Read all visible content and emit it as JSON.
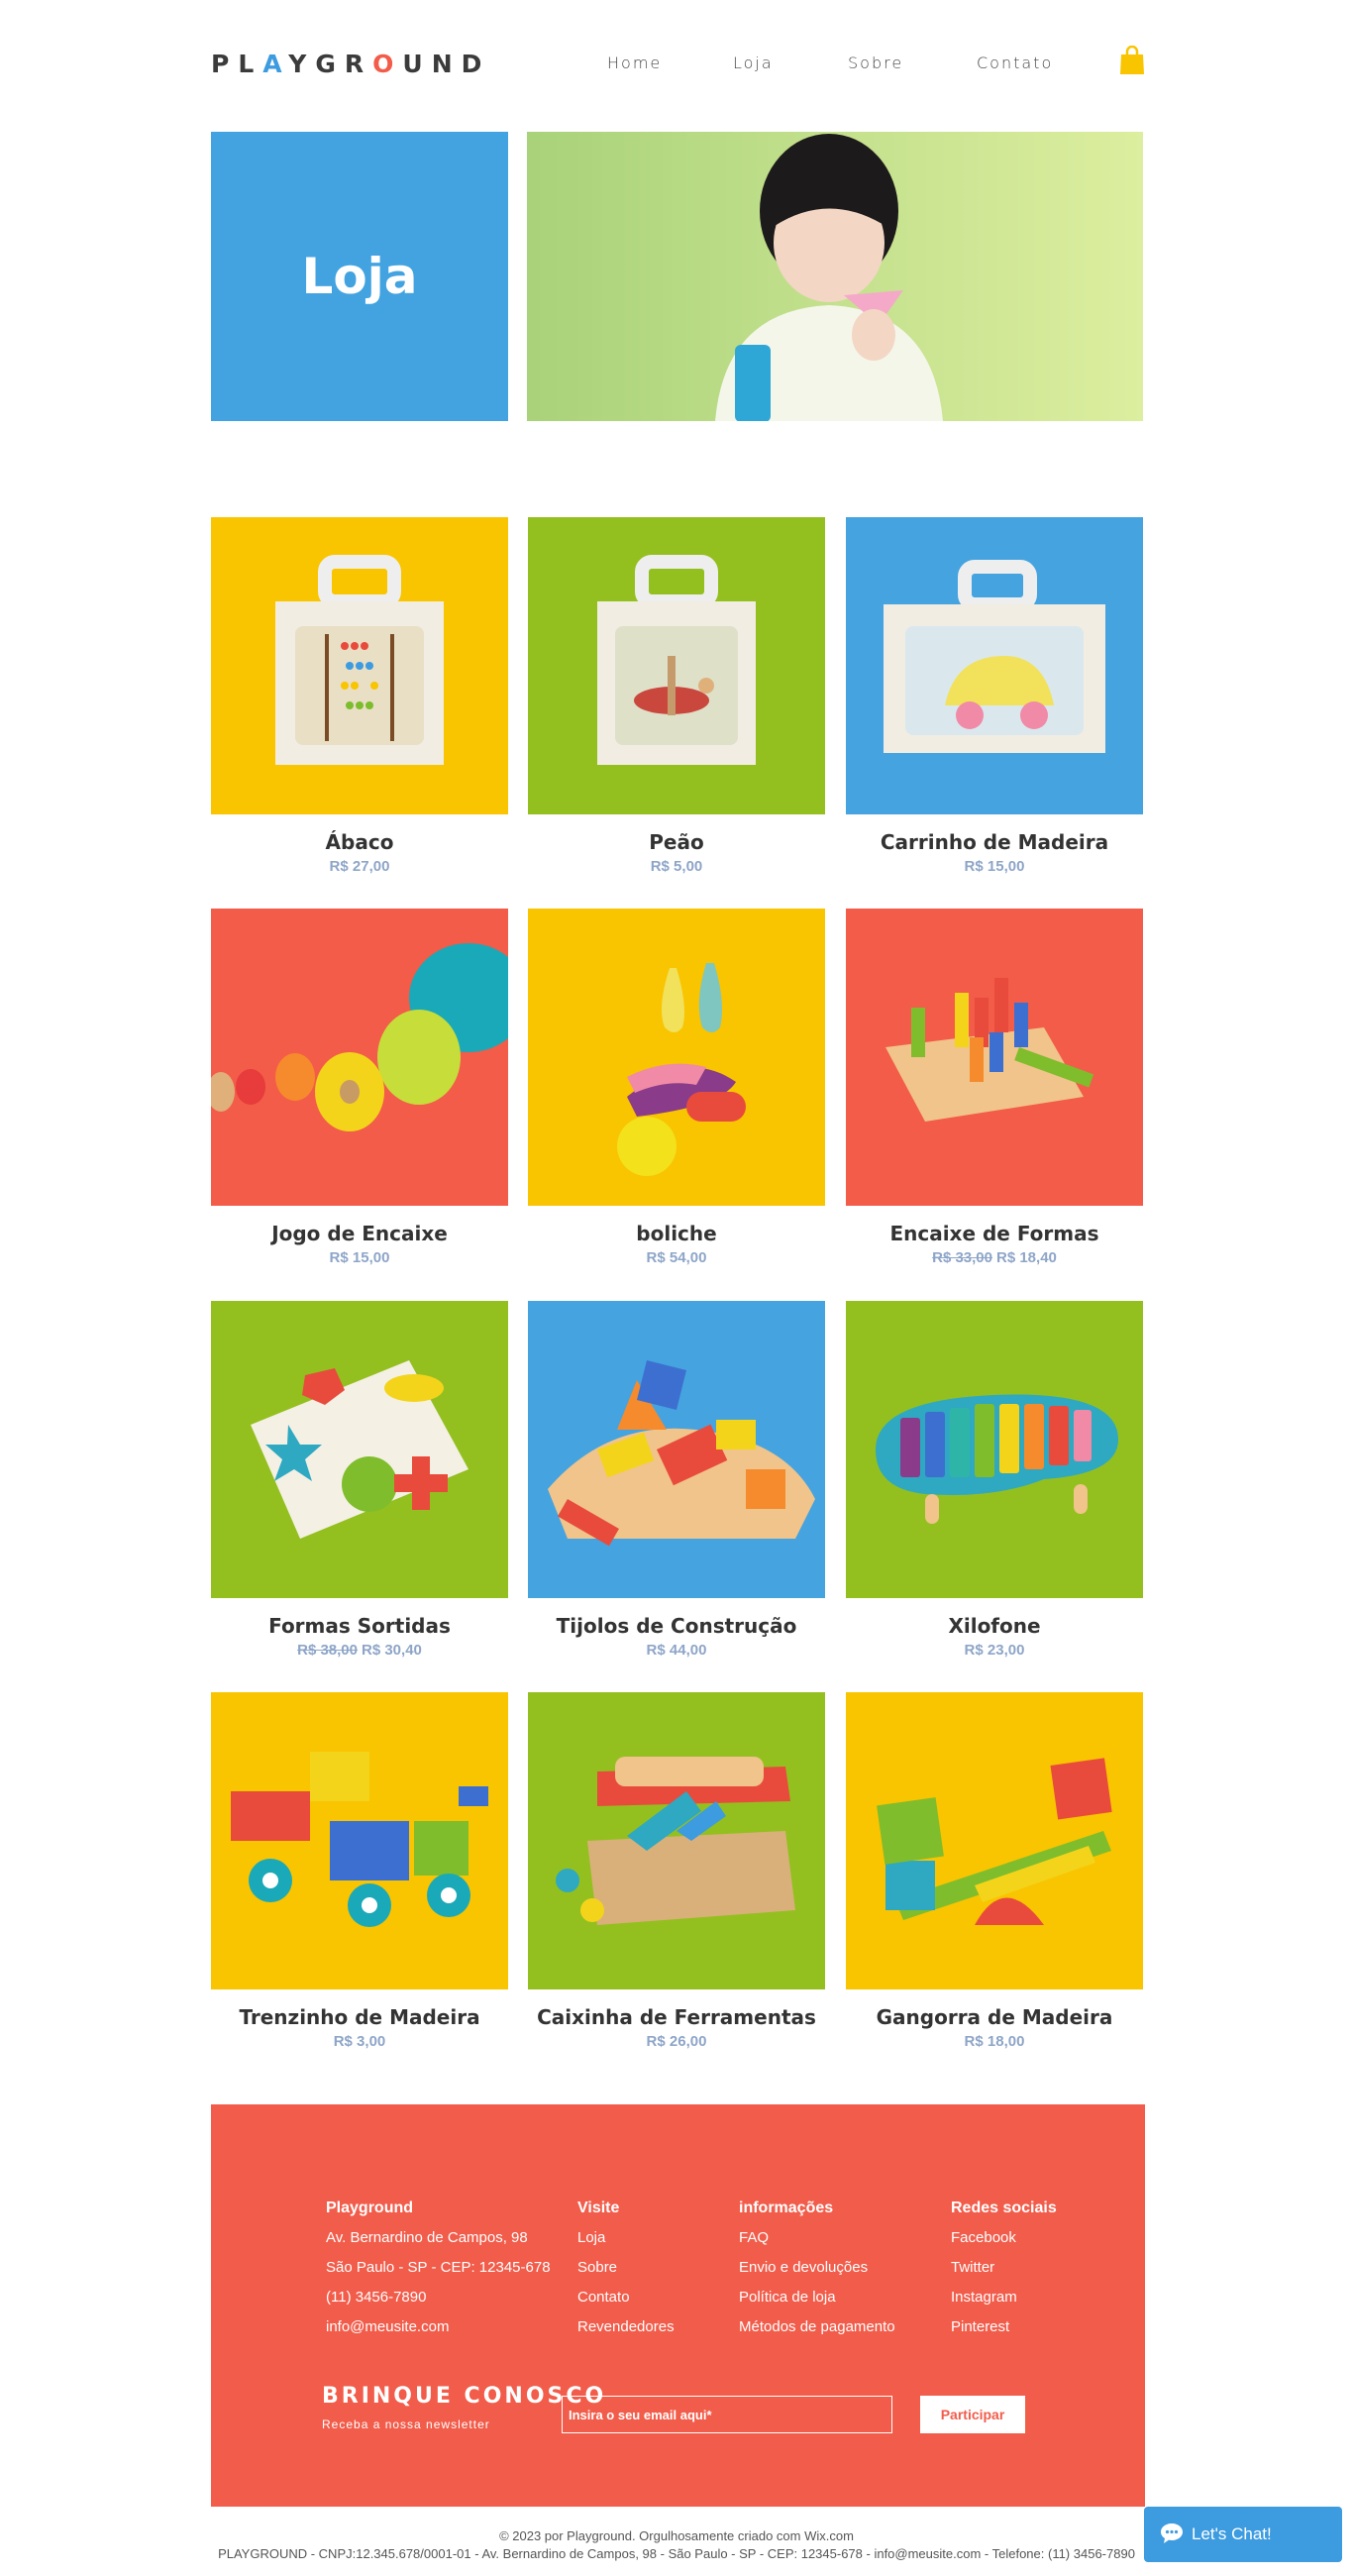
{
  "header": {
    "logo_letters": [
      "P",
      "L",
      "A",
      "Y",
      "G",
      "R",
      "O",
      "U",
      "N",
      "D"
    ],
    "nav": [
      {
        "label": "Home"
      },
      {
        "label": "Loja"
      },
      {
        "label": "Sobre"
      },
      {
        "label": "Contato"
      }
    ],
    "cart_icon": "shopping-bag-icon"
  },
  "hero": {
    "title": "Loja"
  },
  "products": [
    {
      "name": "Ábaco",
      "price": "R$ 27,00",
      "old_price": "",
      "bg": "#f9c400"
    },
    {
      "name": "Peão",
      "price": "R$ 5,00",
      "old_price": "",
      "bg": "#93c01f"
    },
    {
      "name": "Carrinho de Madeira",
      "price": "R$ 15,00",
      "old_price": "",
      "bg": "#45a3e0"
    },
    {
      "name": "Jogo de Encaixe",
      "price": "R$ 15,00",
      "old_price": "",
      "bg": "#f25c48"
    },
    {
      "name": "boliche",
      "price": "R$ 54,00",
      "old_price": "",
      "bg": "#f9c400"
    },
    {
      "name": "Encaixe de Formas",
      "price": "R$ 18,40",
      "old_price": "R$ 33,00",
      "bg": "#f25c48"
    },
    {
      "name": "Formas Sortidas",
      "price": "R$ 30,40",
      "old_price": "R$ 38,00",
      "bg": "#93c01f"
    },
    {
      "name": "Tijolos de Construção",
      "price": "R$ 44,00",
      "old_price": "",
      "bg": "#45a3e0"
    },
    {
      "name": "Xilofone",
      "price": "R$ 23,00",
      "old_price": "",
      "bg": "#93c01f"
    },
    {
      "name": "Trenzinho de Madeira",
      "price": "R$ 3,00",
      "old_price": "",
      "bg": "#f9c400"
    },
    {
      "name": "Caixinha de Ferramentas",
      "price": "R$ 26,00",
      "old_price": "",
      "bg": "#93c01f"
    },
    {
      "name": "Gangorra de Madeira",
      "price": "R$ 18,00",
      "old_price": "",
      "bg": "#f9c400"
    }
  ],
  "footer": {
    "col1": {
      "title": "Playground",
      "lines": [
        "Av. Bernardino de Campos, 98",
        "São Paulo - SP - CEP: 12345-678",
        "(11) 3456-7890",
        "info@meusite.com"
      ]
    },
    "col2": {
      "title": "Visite",
      "lines": [
        "Loja",
        "Sobre",
        "Contato",
        "Revendedores"
      ]
    },
    "col3": {
      "title": "informações",
      "lines": [
        "FAQ",
        "Envio e devoluções",
        "Política de loja",
        "Métodos de pagamento"
      ]
    },
    "col4": {
      "title": "Redes sociais",
      "lines": [
        "Facebook",
        "Twitter",
        "Instagram",
        "Pinterest"
      ]
    },
    "newsletter": {
      "title": "BRINQUE CONOSCO",
      "subtitle": "Receba a nossa newsletter",
      "placeholder": "Insira o seu email aqui*",
      "button": "Participar"
    }
  },
  "copyright": {
    "line1": "© 2023 por Playground. Orgulhosamente criado com Wix.com",
    "line2": "PLAYGROUND - CNPJ:12.345.678/0001-01 - Av. Bernardino de Campos, 98 - São Paulo - SP - CEP: 12345-678 - info@meusite.com - Telefone: (11) 3456-7890"
  },
  "chat": {
    "label": "Let's Chat!",
    "icon": "chat-bubble-icon"
  },
  "colors": {
    "blue": "#42a3e0",
    "red": "#f25c4a",
    "yellow": "#f9c400",
    "green": "#93c01f"
  }
}
